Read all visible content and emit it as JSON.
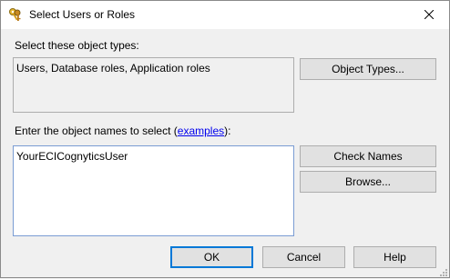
{
  "window": {
    "title": "Select Users or Roles"
  },
  "object_types": {
    "label": "Select these object types:",
    "value": "Users, Database roles, Application roles",
    "button_label": "Object Types..."
  },
  "object_names": {
    "label_prefix": "Enter the object names to select (",
    "link_text": "examples",
    "label_suffix": "):",
    "value": "YourECICognyticsUser",
    "check_names_label": "Check Names",
    "browse_label": "Browse..."
  },
  "footer": {
    "ok_label": "OK",
    "cancel_label": "Cancel",
    "help_label": "Help"
  },
  "icons": {
    "title": "keys-icon",
    "close": "close-icon"
  },
  "colors": {
    "link": "#0000ee",
    "default_button_border": "#0078d7"
  }
}
